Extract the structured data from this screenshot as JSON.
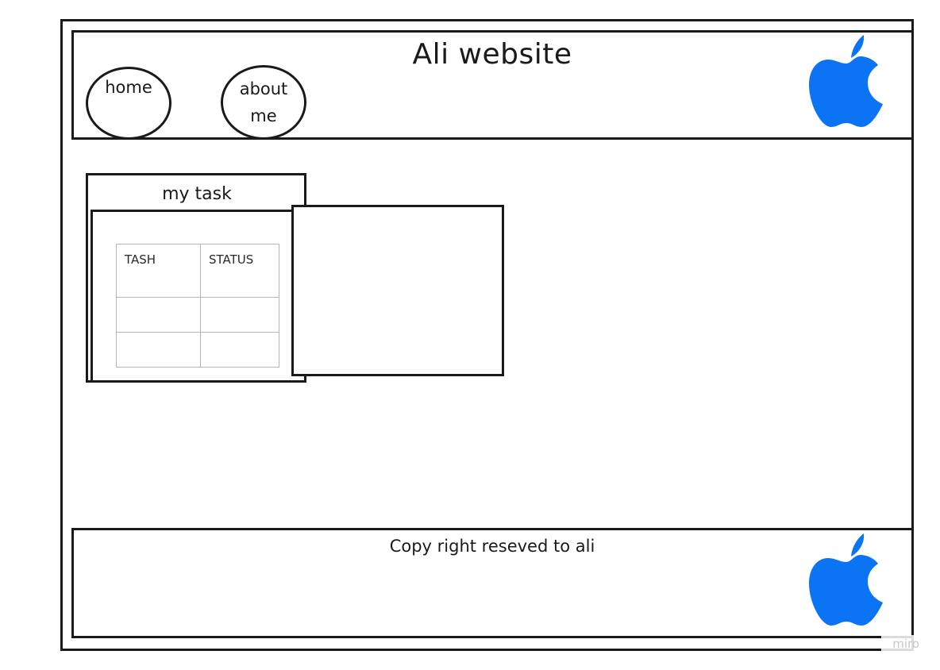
{
  "header": {
    "title": "Ali website",
    "nav": [
      {
        "label": "home"
      },
      {
        "label": "about me"
      }
    ],
    "logo_icon": "apple-icon"
  },
  "task_panel": {
    "title": "my task",
    "table": {
      "columns": [
        "TASH",
        "STATUS"
      ],
      "rows": [
        [
          "",
          ""
        ],
        [
          "",
          ""
        ]
      ]
    }
  },
  "footer": {
    "text": "Copy right reseved to ali",
    "logo_icon": "apple-icon"
  },
  "watermark": "miro",
  "colors": {
    "logo": "#0a74f5",
    "border": "#1a1a1a",
    "table_grid": "#b5b5b5"
  }
}
